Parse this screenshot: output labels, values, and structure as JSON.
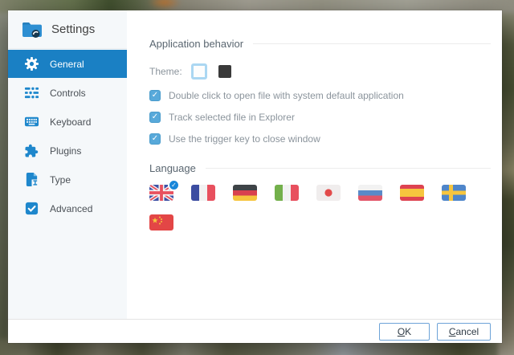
{
  "window": {
    "title": "Settings"
  },
  "sidebar": {
    "items": [
      {
        "label": "General",
        "selected": true
      },
      {
        "label": "Controls",
        "selected": false
      },
      {
        "label": "Keyboard",
        "selected": false
      },
      {
        "label": "Plugins",
        "selected": false
      },
      {
        "label": "Type",
        "selected": false
      },
      {
        "label": "Advanced",
        "selected": false
      }
    ]
  },
  "application_behavior": {
    "title": "Application behavior",
    "theme_label": "Theme:",
    "themes": [
      {
        "name": "light",
        "selected": true
      },
      {
        "name": "dark",
        "selected": false
      }
    ],
    "checkboxes": [
      {
        "label": "Double click to open file with system default application",
        "checked": true
      },
      {
        "label": "Track selected file in Explorer",
        "checked": true
      },
      {
        "label": "Use the trigger key to close window",
        "checked": true
      }
    ]
  },
  "language": {
    "title": "Language",
    "selected": "english",
    "flags": [
      "english",
      "french",
      "german",
      "italian",
      "japanese",
      "russian",
      "spanish",
      "swedish",
      "chinese"
    ]
  },
  "footer": {
    "ok": {
      "ak": "O",
      "rest": "K"
    },
    "cancel": {
      "ak": "C",
      "rest": "ancel"
    }
  },
  "icons": {
    "check": "✓"
  },
  "colors": {
    "accent": "#1a80c4",
    "icon_blue": "#1e87cc",
    "checkbox_blue": "#58a9da"
  }
}
